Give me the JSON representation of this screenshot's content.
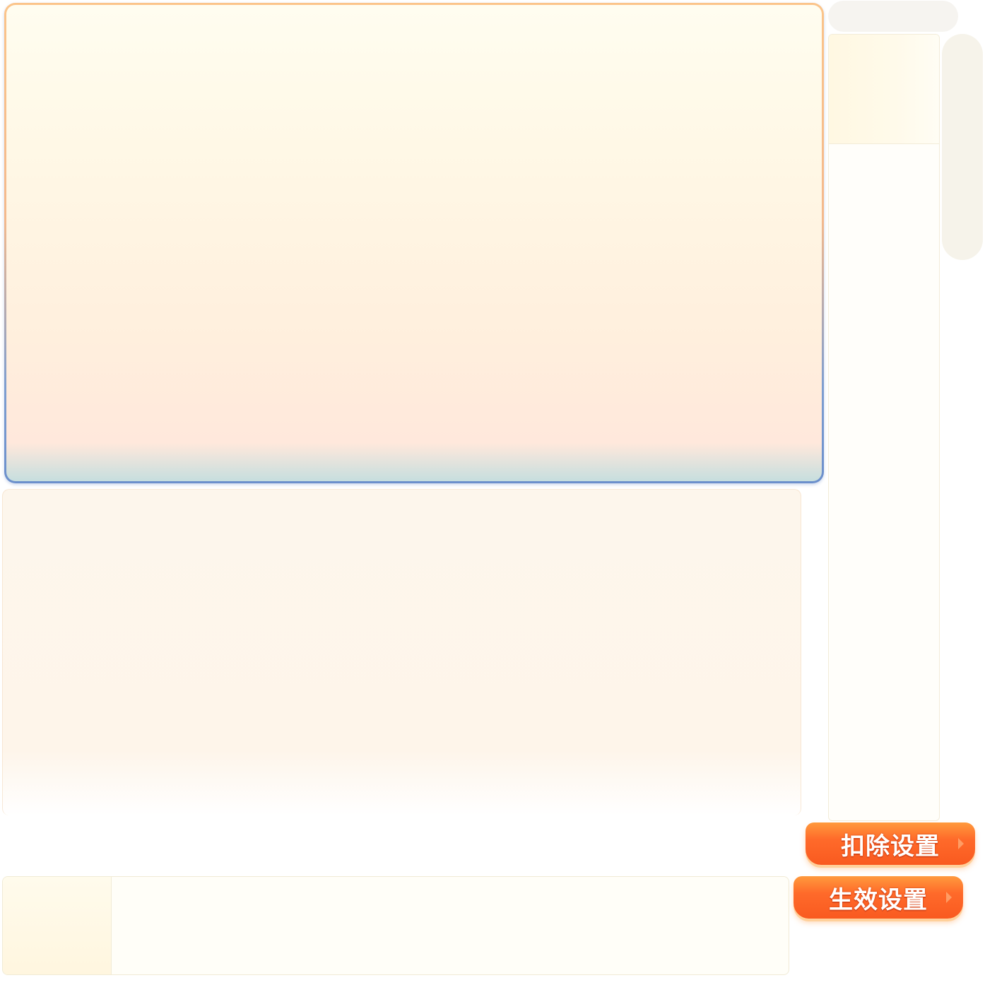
{
  "buttons": {
    "deduct_settings": "扣除设置",
    "effective_settings": "生效设置"
  },
  "colors": {
    "button_orange": "#ff6a2a",
    "panel_border_top": "#fbc48a",
    "panel_border_bottom": "#6b8fcc"
  }
}
